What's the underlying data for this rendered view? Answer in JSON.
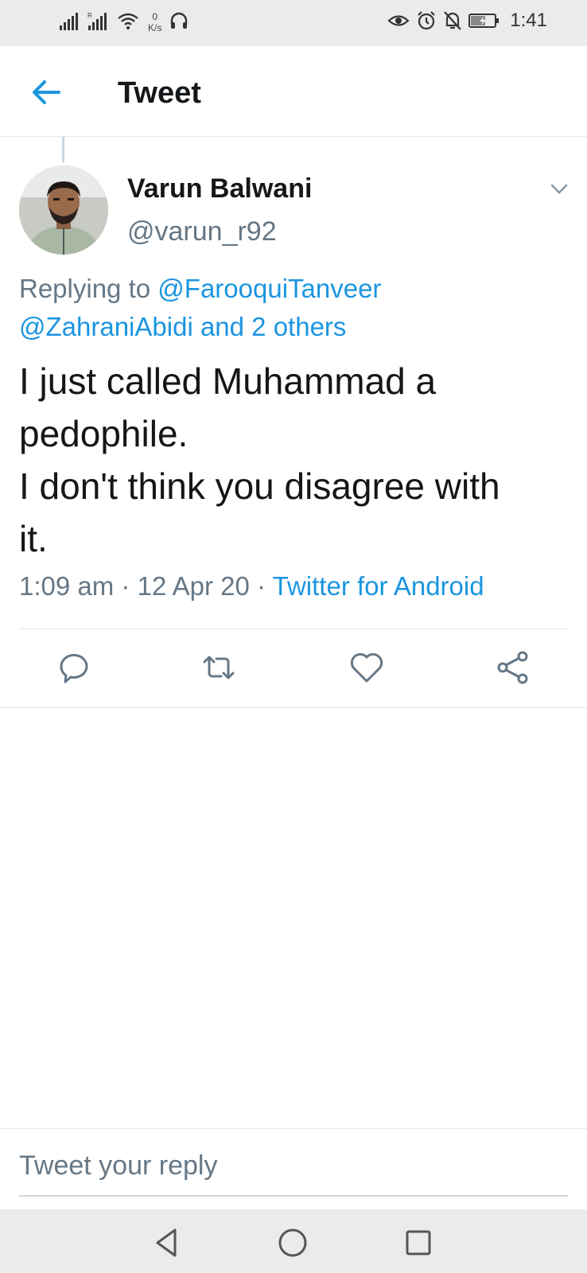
{
  "status_bar": {
    "speed_value": "0",
    "speed_unit": "K/s",
    "time": "1:41"
  },
  "header": {
    "title": "Tweet",
    "back_icon": "arrow-left-icon"
  },
  "tweet": {
    "author_name": "Varun Balwani",
    "author_handle": "@varun_r92",
    "replying_prefix": "Replying to",
    "replying_user1": "@FarooquiTanveer",
    "replying_user2": "@ZahraniAbidi",
    "replying_others": "and 2 others",
    "text_line1": "I just called Muhammad a",
    "text_line2": "pedophile.",
    "text_line3": "I don't think you disagree with",
    "text_line4": "it.",
    "time": "1:09 am",
    "separator": "·",
    "date": "12 Apr 20",
    "source": "Twitter for Android"
  },
  "actions": [
    "reply-icon",
    "retweet-icon",
    "like-icon",
    "share-icon"
  ],
  "composer": {
    "placeholder": "Tweet your reply"
  },
  "colors": {
    "accent": "#1b95e0",
    "secondary_text": "#657786",
    "primary_text": "#14171a",
    "divider": "#e1e8ed"
  }
}
